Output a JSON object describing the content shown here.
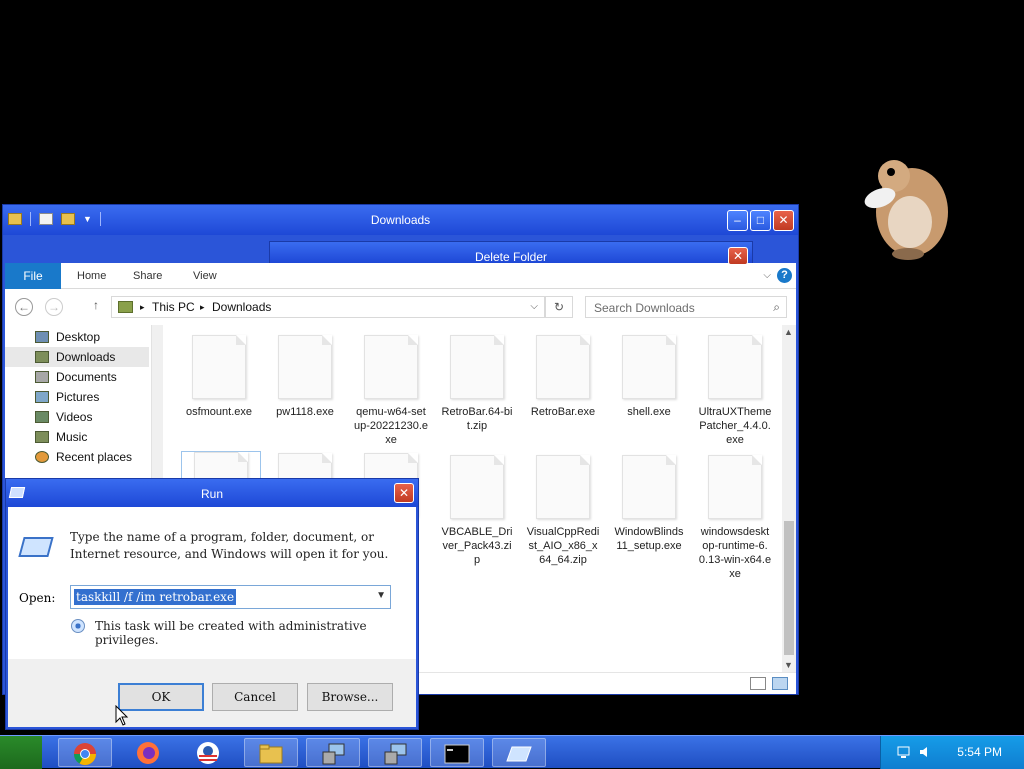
{
  "explorer": {
    "title": "Downloads",
    "tabs": [
      "File",
      "Home",
      "Share",
      "View"
    ],
    "breadcrumb": [
      "This PC",
      "Downloads"
    ],
    "search_placeholder": "Search Downloads",
    "nav": [
      {
        "label": "Desktop"
      },
      {
        "label": "Downloads"
      },
      {
        "label": "Documents"
      },
      {
        "label": "Pictures"
      },
      {
        "label": "Videos"
      },
      {
        "label": "Music"
      },
      {
        "label": "Recent places"
      }
    ],
    "files": [
      "osfmount.exe",
      "pw1118.exe",
      "qemu-w64-setup-20221230.exe",
      "RetroBar.64-bit.zip",
      "RetroBar.exe",
      "shell.exe",
      "UltraUXThemePatcher_4.4.0.exe",
      "",
      "",
      "",
      "VBCABLE_Driver_Pack43.zip",
      "VisualCppRedist_AIO_x86_x64_64.zip",
      "WindowBlinds11_setup.exe",
      "windowsdesktop-runtime-6.0.13-win-x64.exe"
    ]
  },
  "delete_folder": {
    "title": "Delete Folder"
  },
  "run": {
    "title": "Run",
    "description": "Type the name of a program, folder, document, or Internet resource, and Windows will open it for you.",
    "open_label": "Open:",
    "open_value": "taskkill /f /im retrobar.exe",
    "admin_note": "This task will be created with administrative privileges.",
    "ok": "OK",
    "cancel": "Cancel",
    "browse": "Browse..."
  },
  "taskbar": {
    "clock": "5:54 PM",
    "items": [
      "chrome-icon",
      "firefox-icon",
      "obama-logo-icon",
      "file-explorer-icon",
      "installer-icon",
      "installer-icon",
      "cmd-icon",
      "run-icon"
    ]
  }
}
